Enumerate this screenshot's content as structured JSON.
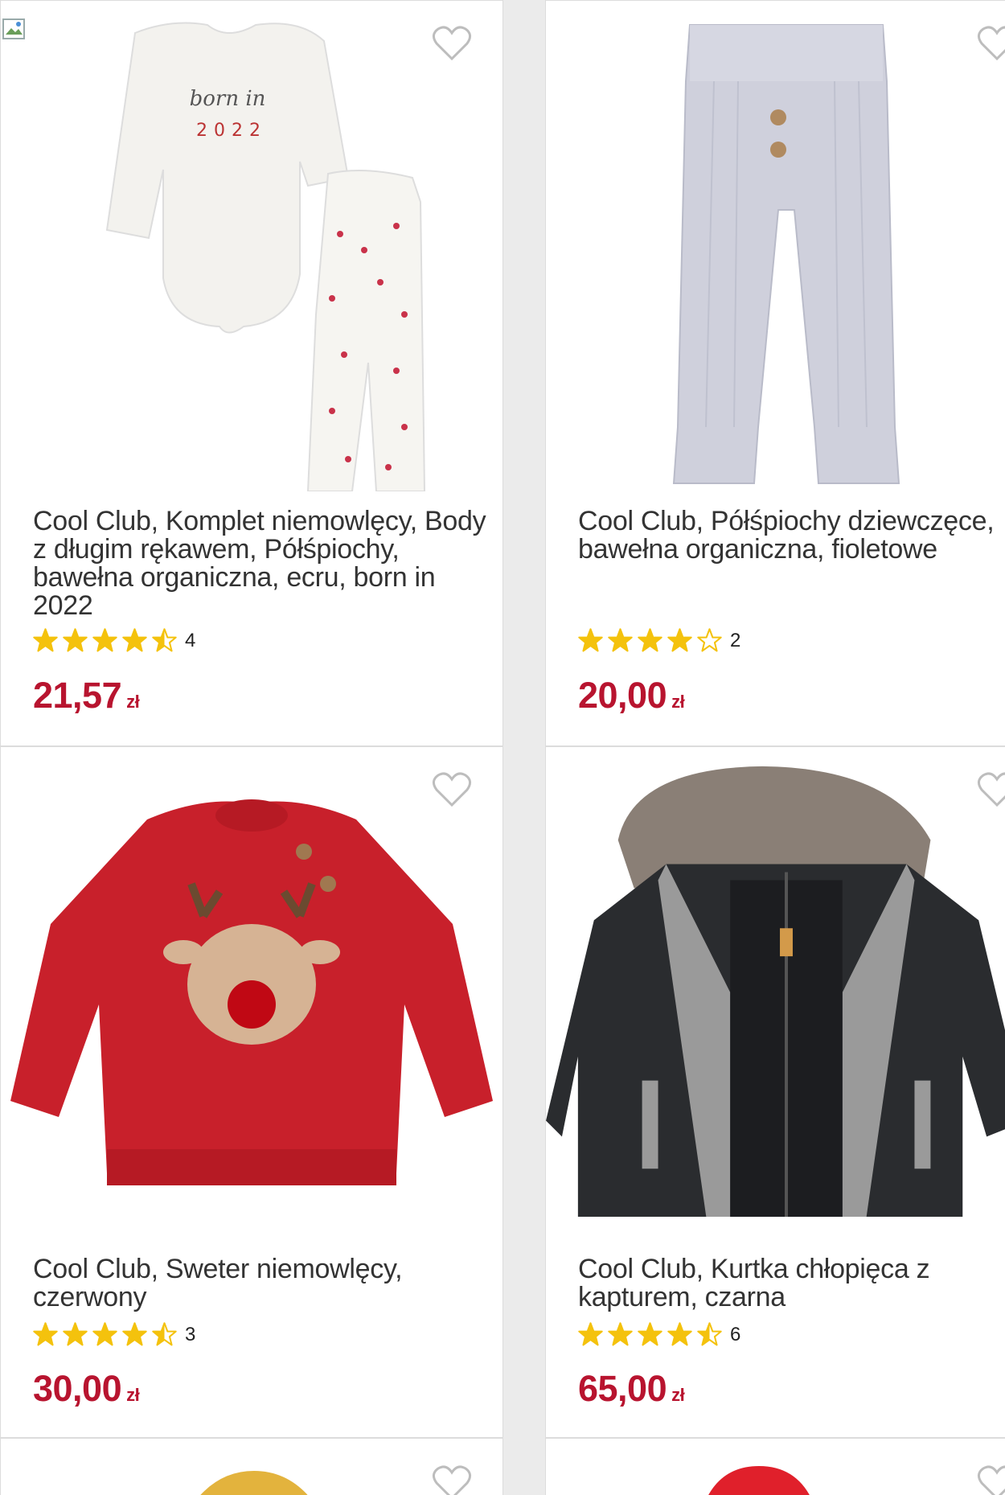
{
  "colors": {
    "price": "#b8142f",
    "star": "#f4c20d",
    "background": "#ebebeb"
  },
  "products": [
    {
      "title": "Cool Club, Komplet niemowlęcy, Body z długim rękawem, Półśpiochy, bawełna organiczna, ecru, born in 2022",
      "image_icon": "bodysuit-set-image",
      "print_text_1": "born in",
      "print_text_2": "2022",
      "rating": 4.5,
      "review_count": "4",
      "price_value": "21,57",
      "currency": "zł"
    },
    {
      "title": "Cool Club, Półśpiochy dziewczęce, bawełna organiczna, fioletowe",
      "image_icon": "pants-image",
      "rating": 4,
      "review_count": "2",
      "price_value": "20,00",
      "currency": "zł"
    },
    {
      "title": "Cool Club, Sweter niemowlęcy, czerwony",
      "image_icon": "sweater-image",
      "rating": 4.5,
      "review_count": "3",
      "price_value": "30,00",
      "currency": "zł"
    },
    {
      "title": "Cool Club, Kurtka chłopięca z kapturem, czarna",
      "image_icon": "jacket-image",
      "rating": 4.5,
      "review_count": "6",
      "price_value": "65,00",
      "currency": "zł"
    }
  ]
}
